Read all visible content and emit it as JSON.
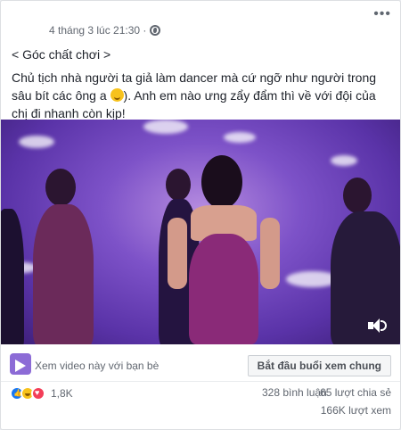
{
  "post": {
    "timestamp": "4 tháng 3 lúc 21:30 ·",
    "more_label": "•••",
    "heading": "< Góc chất chơi >",
    "body_before_emoji": "Chủ tịch nhà người ta giả làm dancer mà cứ ngỡ như người trong sâu bít các ông a ",
    "body_after_emoji": "). Anh em nào ưng zẩy đẩm thì về với đội của chị đi nhanh còn kịp!"
  },
  "watch": {
    "label": "Xem video này với bạn bè",
    "button": "Bắt đầu buổi xem chung"
  },
  "stats": {
    "reaction_count": "1,8K",
    "comments": "328 bình luận",
    "shares": "65 lượt chia sẻ",
    "views": "166K lượt xem"
  },
  "icons": {
    "reactions": [
      "like-icon",
      "haha-icon",
      "love-icon"
    ],
    "privacy": "globe-icon",
    "video_sound": "speaker-icon",
    "watch_party": "watch-party-icon"
  },
  "colors": {
    "like": "#1877f2",
    "haha": "#f7c21c",
    "love": "#f33e58",
    "video_tint": "#7d52c8"
  }
}
